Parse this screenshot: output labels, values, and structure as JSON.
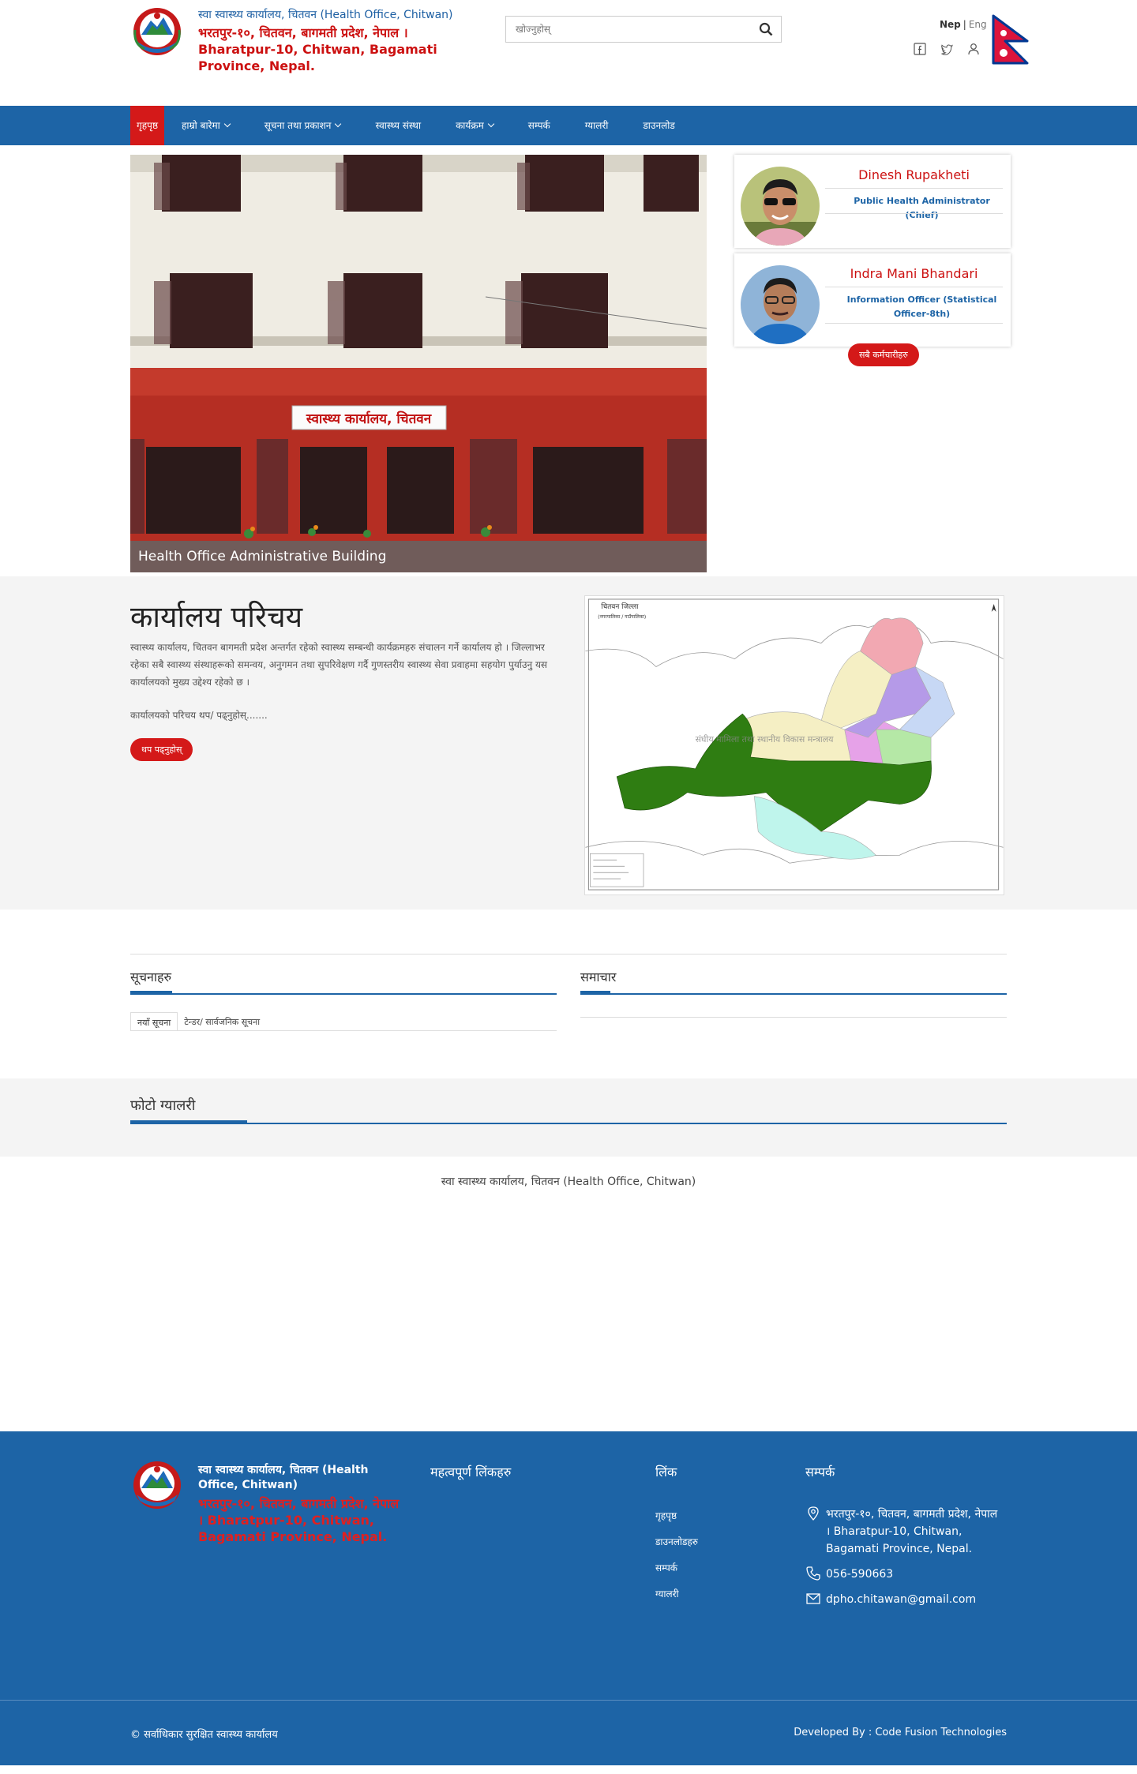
{
  "header": {
    "title_line1": "स्वा स्वास्थ्य कार्यालय, चितवन (Health Office, Chitwan)",
    "title_line2": "भरतपुर-१०, चितवन, बागमती प्रदेश, नेपाल । Bharatpur-10, Chitwan, Bagamati Province, Nepal.",
    "search_placeholder": "खोज्नुहोस्",
    "lang_nep": "Nep",
    "lang_sep": "|",
    "lang_eng": "Eng"
  },
  "nav": {
    "items": [
      {
        "label": "गृहपृष्ठ",
        "active": true,
        "dropdown": false
      },
      {
        "label": "हाम्रो बारेमा",
        "active": false,
        "dropdown": true
      },
      {
        "label": "सूचना तथा प्रकाशन",
        "active": false,
        "dropdown": true
      },
      {
        "label": "स्वास्थ्य संस्था",
        "active": false,
        "dropdown": true
      },
      {
        "label": "कार्यक्रम",
        "active": false,
        "dropdown": false
      },
      {
        "label": "सम्पर्क",
        "active": false,
        "dropdown": false
      },
      {
        "label": "ग्यालरी",
        "active": false,
        "dropdown": true
      },
      {
        "label": "डाउनलोड",
        "active": false,
        "dropdown": false
      }
    ]
  },
  "hero": {
    "sign_text": "स्वास्थ्य कार्यालय, चितवन",
    "caption": "Health Office Administrative Building"
  },
  "profiles": [
    {
      "name": "Dinesh Rupakheti",
      "role": "Public Health Administrator (Chief)"
    },
    {
      "name": "Indra Mani Bhandari",
      "role": "Information Officer (Statistical Officer-8th)"
    }
  ],
  "all_staff_button": "सबै कर्मचारीहरु",
  "intro": {
    "heading": "कार्यालय परिचय",
    "paragraph": "स्वास्थ्य कार्यालय, चितवन बागमती प्रदेश अन्तर्गत रहेको स्वास्थ्य सम्बन्धी कार्यक्रमहरु संचालन गर्ने कार्यालय हो । जिल्लाभर रहेका सबै स्वास्थ्य संस्थाहरूको समन्वय, अनुगमन तथा सुपरिवेक्षण गर्दै गुणस्तरीय स्वास्थ्य सेवा प्रवाहमा सहयोग पुर्याउनु यस कार्यालयको मुख्य उद्देश्य रहेको छ ।",
    "more_text": "कार्यालयको परिचय थप/ पढ्नुहोस्.......",
    "more_button": "थप पढ्नुहोस्",
    "map_title": "चितवन जिल्ला",
    "map_subtitle": "(नगरपालिका / गाउँपालिका)",
    "map_center_label": "संघीय मामिला तथा स्थानीय विकास मन्त्रालय"
  },
  "news": {
    "left_title": "सूचनाहरु",
    "right_title": "समाचार",
    "tab_active": "नयाँ सूचना",
    "tab_other": "टेन्डर/ सार्वजनिक सूचना"
  },
  "gallery": {
    "title": "फोटो ग्यालरी"
  },
  "facebook_label": "स्वा स्वास्थ्य कार्यालय, चितवन (Health Office, Chitwan)",
  "footer": {
    "title_line1": "स्वा स्वास्थ्य कार्यालय, चितवन (Health Office, Chitwan)",
    "title_line2": "भरतपुर-१०, चितवन, बागमती प्रदेश, नेपाल । Bharatpur-10, Chitwan, Bagamati Province, Nepal.",
    "col2_title": "महत्वपूर्ण लिंकहरु",
    "col3_title": "लिंक",
    "links": [
      "गृहपृष्ठ",
      "डाउनलोडहरु",
      "सम्पर्क",
      "ग्यालरी"
    ],
    "col4_title": "सम्पर्क",
    "address": "भरतपुर-१०, चितवन, बागमती प्रदेश, नेपाल । Bharatpur-10, Chitwan, Bagamati Province, Nepal.",
    "phone": "056-590663",
    "email": "dpho.chitawan@gmail.com",
    "copyright": "© सर्वाधिकार सुरक्षित स्वास्थ्य कार्यालय",
    "developer": "Developed By : Code Fusion Technologies"
  },
  "colors": {
    "primary_blue": "#1d64a6",
    "accent_red": "#d41919",
    "intro_bg": "#f4f4f4"
  },
  "icons": [
    "search-icon",
    "facebook-icon",
    "twitter-icon",
    "user-icon",
    "location-icon",
    "phone-icon",
    "mail-icon"
  ]
}
